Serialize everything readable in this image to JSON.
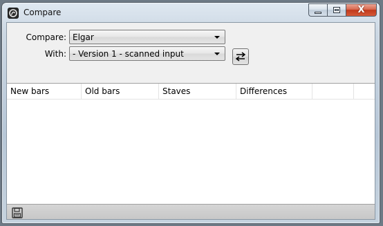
{
  "window": {
    "title": "Compare",
    "close_glyph": "X",
    "icons": {
      "app": "app-logo-icon",
      "minimize": "minimize-icon",
      "maximize": "maximize-icon",
      "close": "close-icon"
    }
  },
  "form": {
    "compare_label": "Compare:",
    "compare_value": "Elgar",
    "with_label": "With:",
    "with_value": "- Version 1 - scanned input",
    "swap_icon": "swap-arrows-icon"
  },
  "table": {
    "columns": [
      "New bars",
      "Old bars",
      "Staves",
      "Differences",
      ""
    ],
    "rows": []
  },
  "statusbar": {
    "save_icon": "save-disk-icon"
  }
}
